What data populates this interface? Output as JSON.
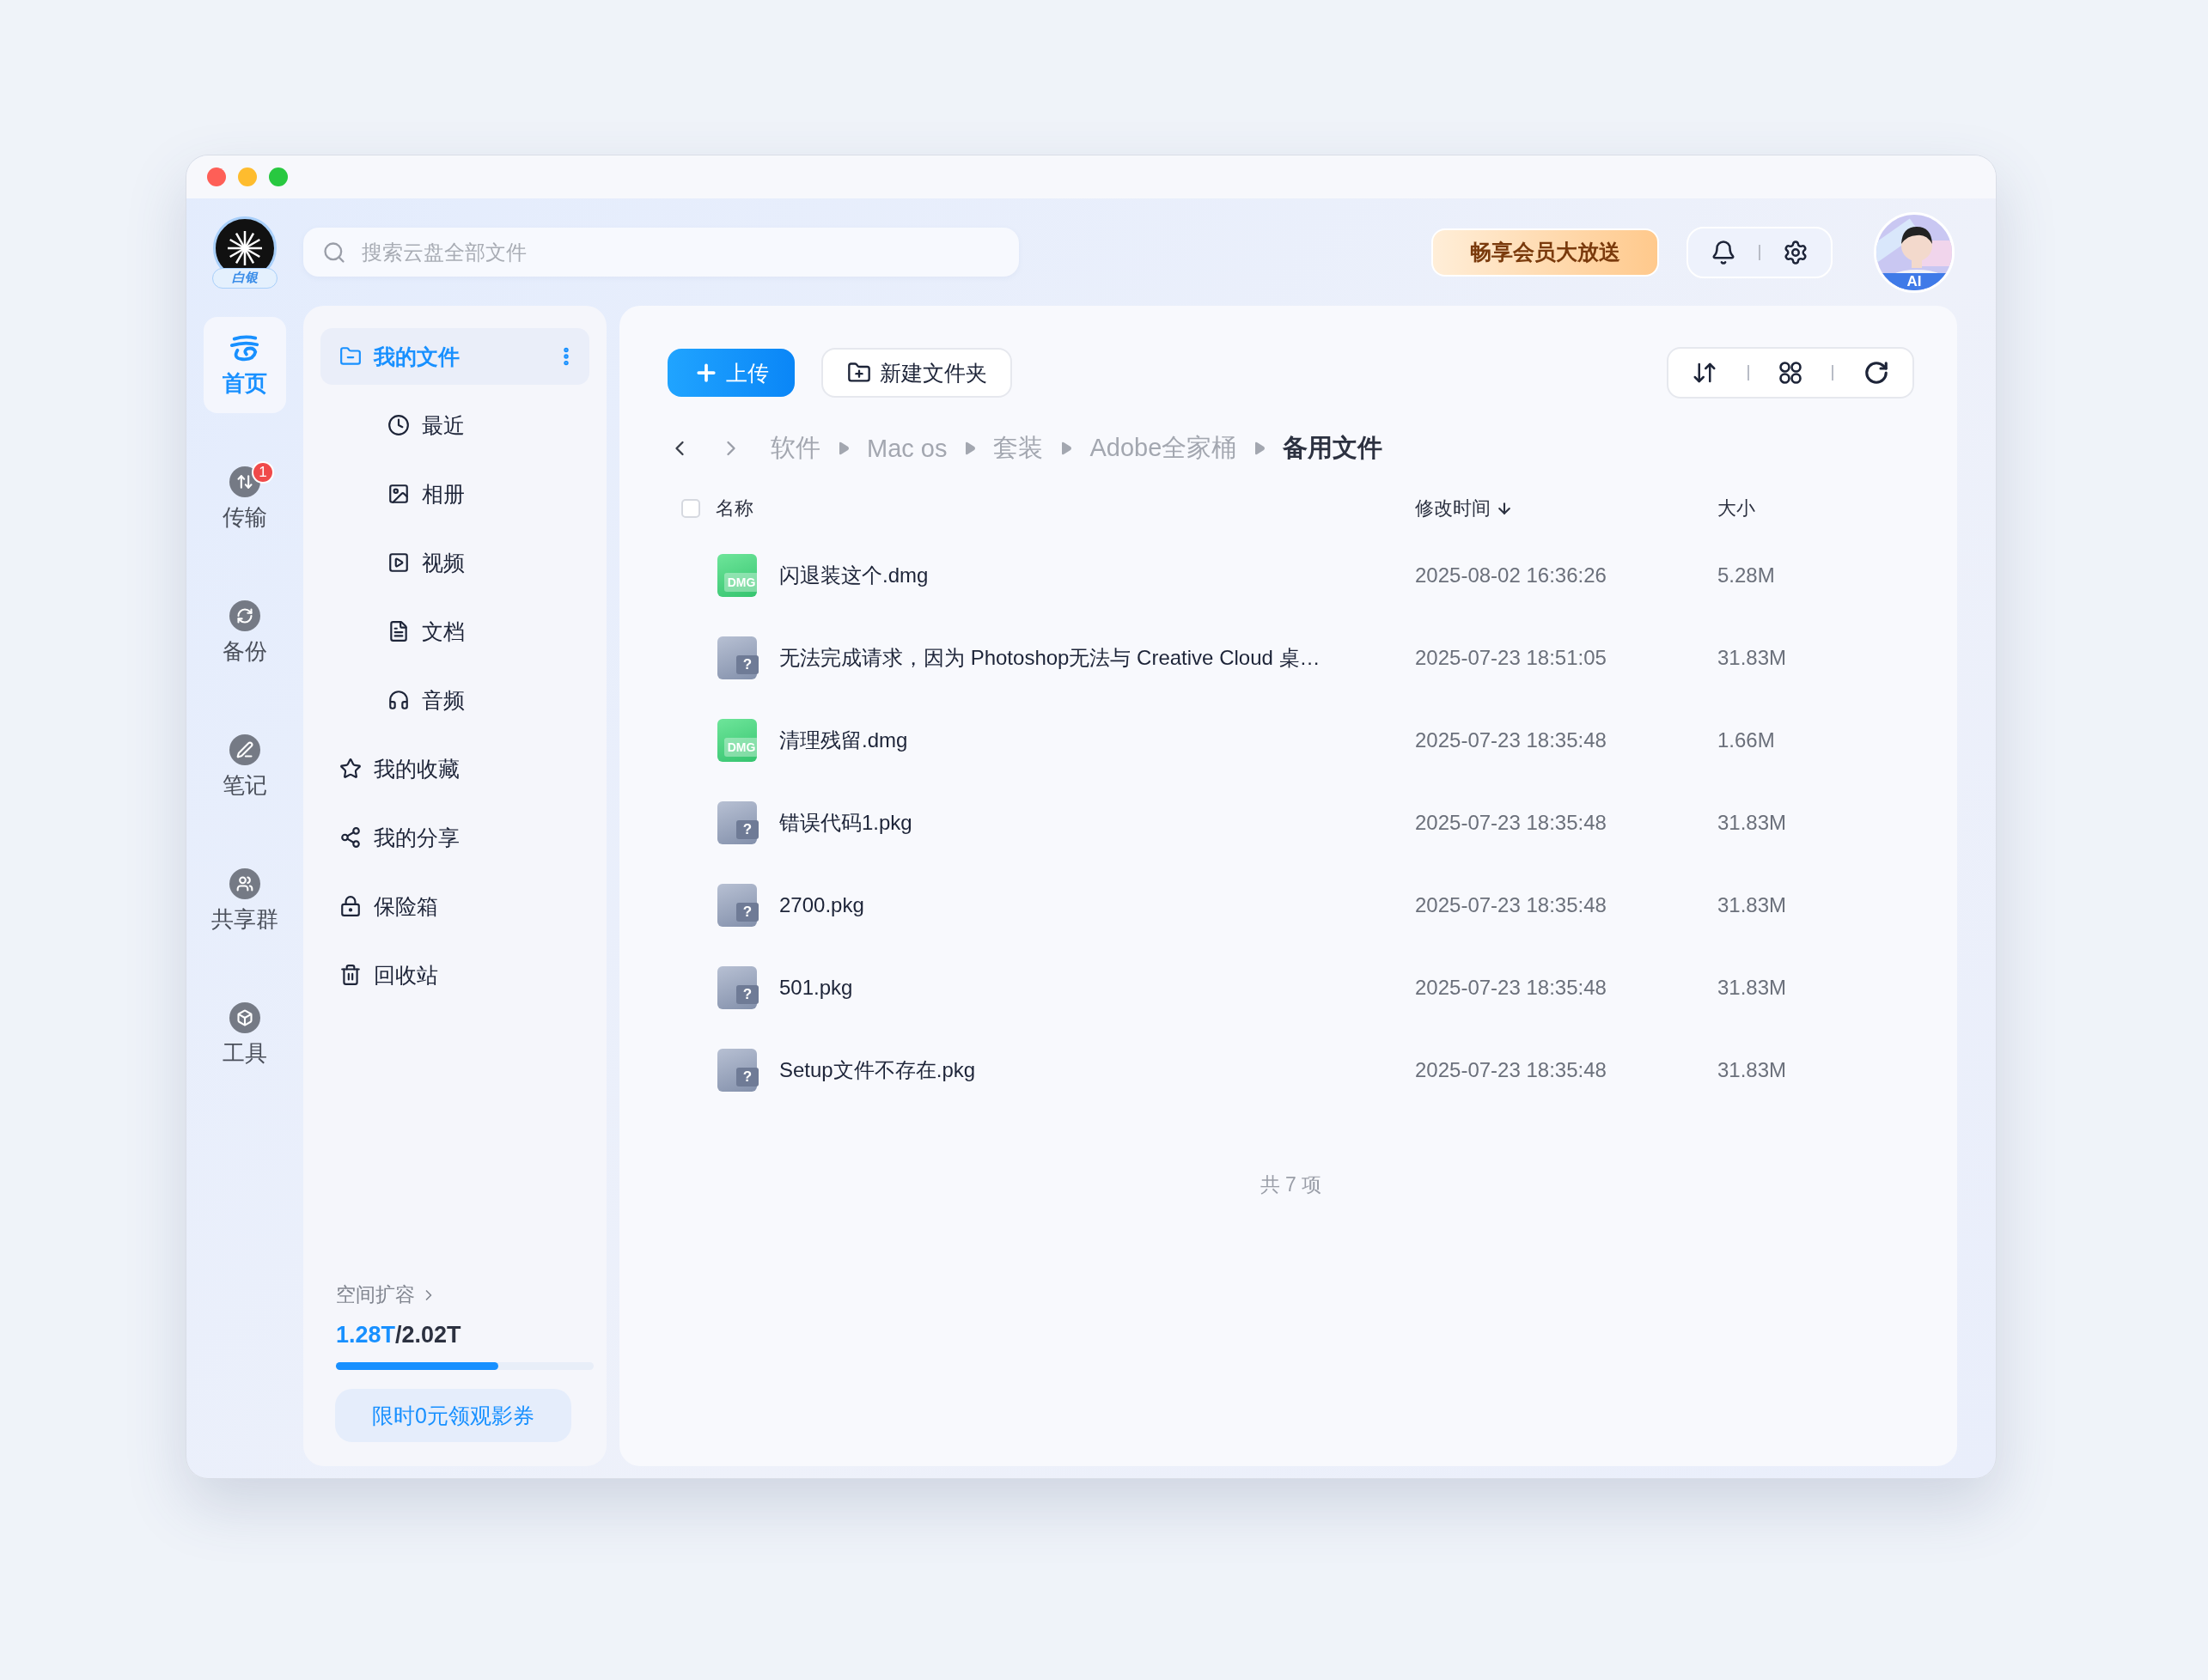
{
  "account": {
    "badge": "白银"
  },
  "search": {
    "placeholder": "搜索云盘全部文件"
  },
  "promo": {
    "label": "畅享会员大放送"
  },
  "avatar": {
    "label": "AI"
  },
  "rail": [
    {
      "label": "首页",
      "selected": true
    },
    {
      "label": "传输",
      "selected": false,
      "badge": "1"
    },
    {
      "label": "备份",
      "selected": false
    },
    {
      "label": "笔记",
      "selected": false
    },
    {
      "label": "共享群",
      "selected": false
    },
    {
      "label": "工具",
      "selected": false
    }
  ],
  "nav": [
    {
      "label": "我的文件",
      "selected": true,
      "children": [
        {
          "label": "最近",
          "selected": false
        },
        {
          "label": "相册",
          "selected": false
        },
        {
          "label": "视频",
          "selected": false
        },
        {
          "label": "文档",
          "selected": false
        },
        {
          "label": "音频",
          "selected": false
        }
      ]
    },
    {
      "label": "我的收藏",
      "selected": false
    },
    {
      "label": "我的分享",
      "selected": false
    },
    {
      "label": "保险箱",
      "selected": false
    },
    {
      "label": "回收站",
      "selected": false
    }
  ],
  "storage": {
    "link": "空间扩容",
    "used": "1.28T",
    "total": "/2.02T",
    "level": 0.63,
    "coupon": "限时0元领观影券"
  },
  "toolbar": {
    "upload": "上传",
    "new_folder": "新建文件夹"
  },
  "breadcrumb": [
    "软件",
    "Mac os",
    "套装",
    "Adobe全家桶",
    "备用文件"
  ],
  "table": {
    "select_all": {
      "checked": false
    },
    "columns": [
      {
        "label": "名称",
        "sorted": false
      },
      {
        "label": "修改时间",
        "sorted": true
      },
      {
        "label": "大小",
        "sorted": false
      }
    ],
    "rows": [
      {
        "kind": "dmg",
        "icon_label": "DMG",
        "name": "闪退装这个.dmg",
        "modified": "2025-08-02 16:36:26",
        "size": "5.28M"
      },
      {
        "kind": "unknown",
        "icon_label": "?",
        "name": "无法完成请求，因为 Photoshop无法与 Creative Cloud 桌…",
        "modified": "2025-07-23 18:51:05",
        "size": "31.83M"
      },
      {
        "kind": "dmg",
        "icon_label": "DMG",
        "name": "清理残留.dmg",
        "modified": "2025-07-23 18:35:48",
        "size": "1.66M"
      },
      {
        "kind": "unknown",
        "icon_label": "?",
        "name": "错误代码1.pkg",
        "modified": "2025-07-23 18:35:48",
        "size": "31.83M"
      },
      {
        "kind": "unknown",
        "icon_label": "?",
        "name": "2700.pkg",
        "modified": "2025-07-23 18:35:48",
        "size": "31.83M"
      },
      {
        "kind": "unknown",
        "icon_label": "?",
        "name": "501.pkg",
        "modified": "2025-07-23 18:35:48",
        "size": "31.83M"
      },
      {
        "kind": "unknown",
        "icon_label": "?",
        "name": "Setup文件不存在.pkg",
        "modified": "2025-07-23 18:35:48",
        "size": "31.83M"
      }
    ],
    "footer": "共 7 项"
  }
}
